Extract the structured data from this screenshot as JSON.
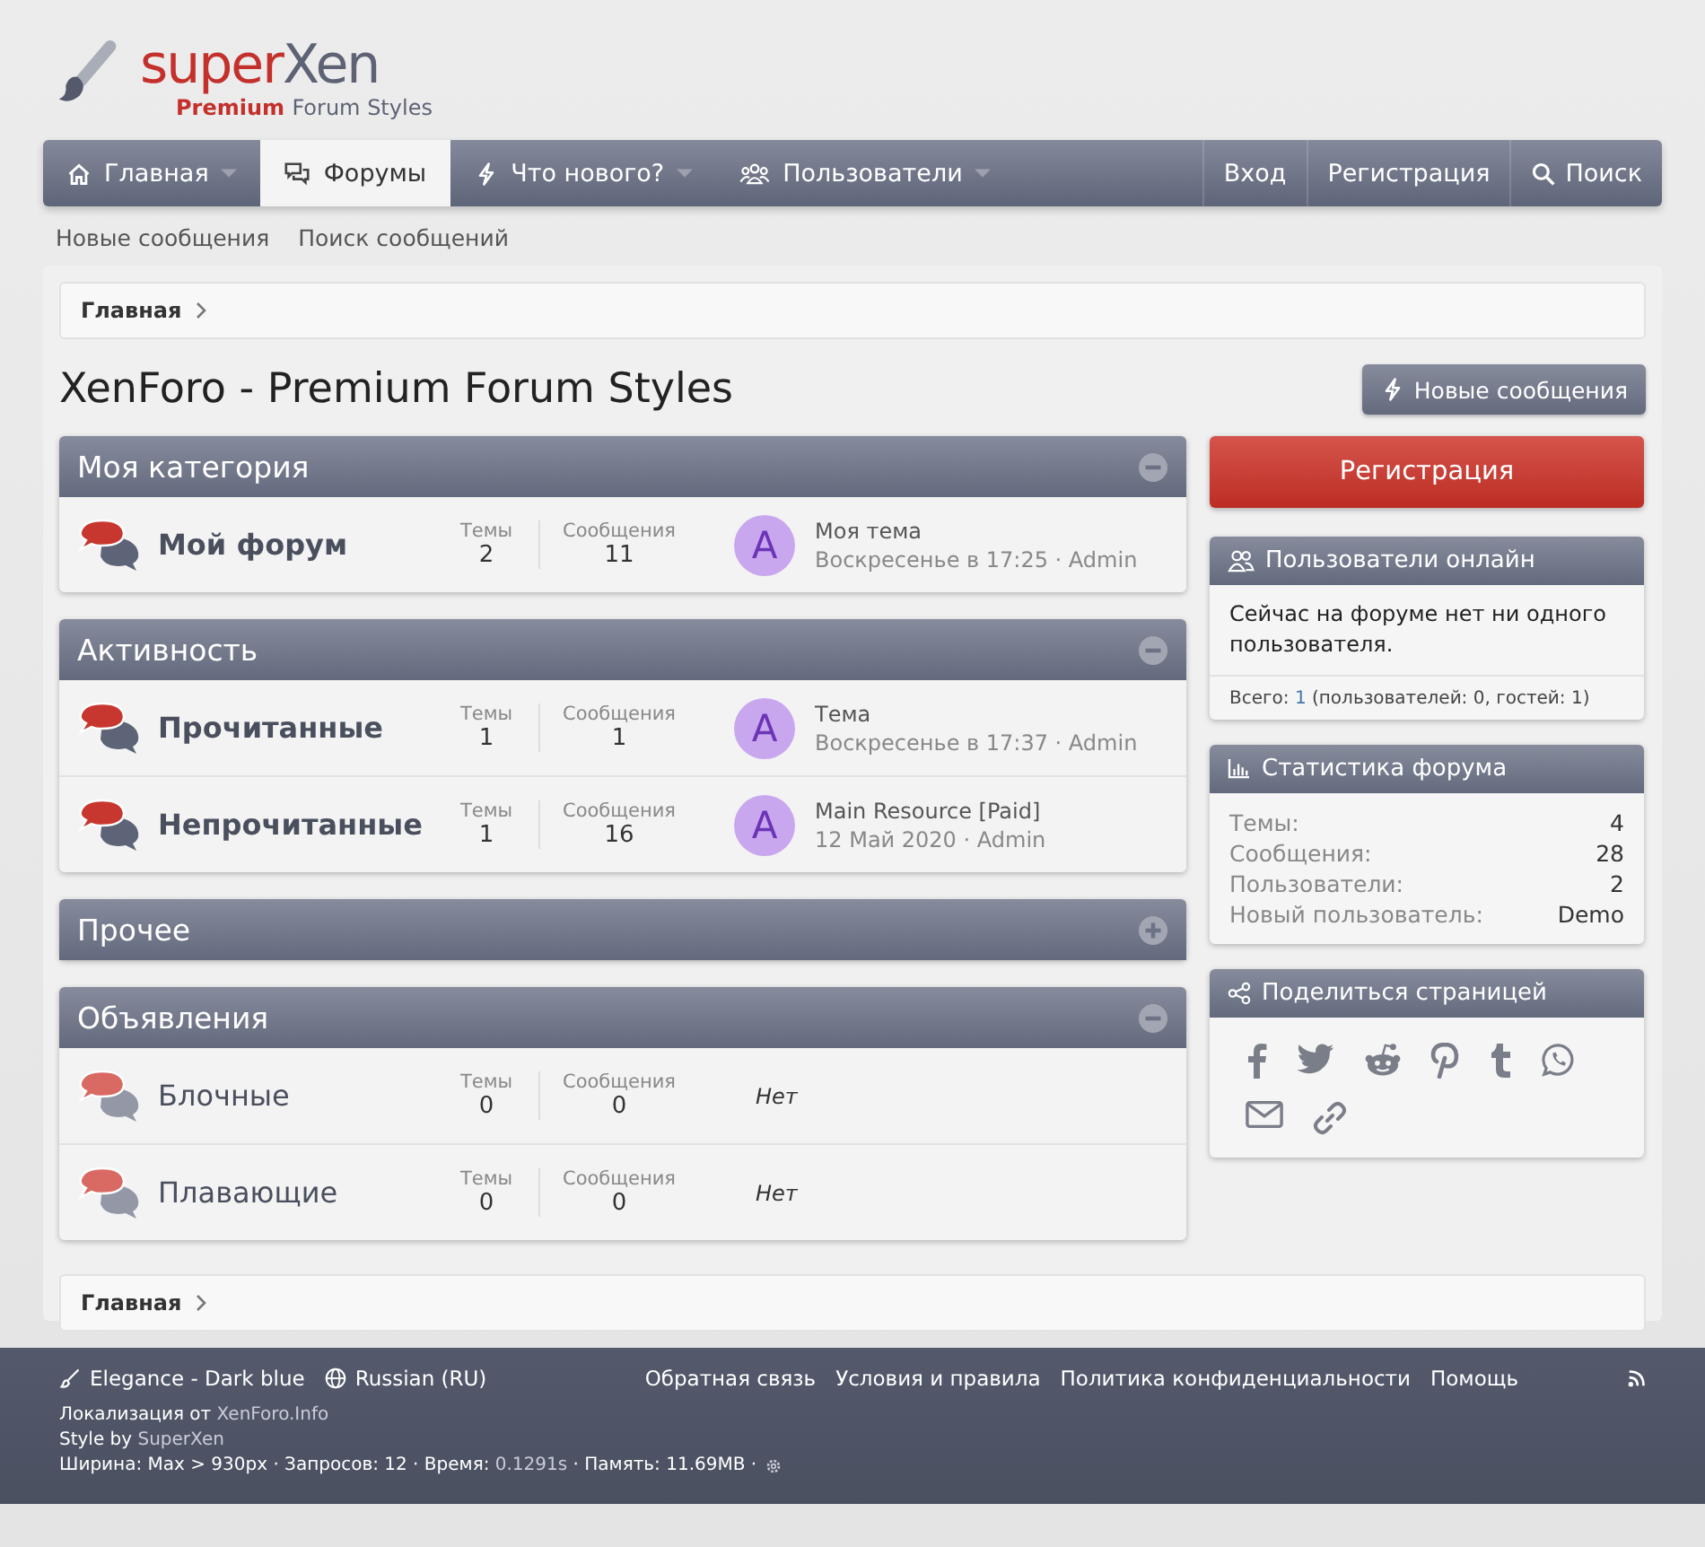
{
  "logo": {
    "name_first": "super",
    "name_second": "Xen",
    "tagline_first": "Premium",
    "tagline_second": "Forum Styles"
  },
  "nav": {
    "tabs": [
      {
        "label": "Главная",
        "selected": false,
        "has_menu": true
      },
      {
        "label": "Форумы",
        "selected": true,
        "has_menu": false
      },
      {
        "label": "Что нового?",
        "selected": false,
        "has_menu": true
      },
      {
        "label": "Пользователи",
        "selected": false,
        "has_menu": true
      }
    ],
    "actions": [
      {
        "label": "Вход",
        "kind": "login"
      },
      {
        "label": "Регистрация",
        "kind": "register"
      },
      {
        "label": "Поиск",
        "kind": "search"
      }
    ]
  },
  "subnav": [
    "Новые сообщения",
    "Поиск сообщений"
  ],
  "breadcrumb_top": "Главная",
  "page_title": "XenForo - Premium Forum Styles",
  "new_posts_button": "Новые сообщения",
  "categories": [
    {
      "title": "Моя категория",
      "collapsed": false,
      "nodes": [
        {
          "title": "Мой форум",
          "unread": true,
          "stats": [
            {
              "label": "Темы",
              "value": "2"
            },
            {
              "label": "Сообщения",
              "value": "11"
            }
          ],
          "last_post": {
            "avatar_letter": "A",
            "title": "Моя тема",
            "meta": "Воскресенье в 17:25 · Admin"
          }
        }
      ]
    },
    {
      "title": "Активность",
      "collapsed": false,
      "nodes": [
        {
          "title": "Прочитанные",
          "unread": true,
          "stats": [
            {
              "label": "Темы",
              "value": "1"
            },
            {
              "label": "Сообщения",
              "value": "1"
            }
          ],
          "last_post": {
            "avatar_letter": "A",
            "title": "Тема",
            "meta": "Воскресенье в 17:37 · Admin"
          }
        },
        {
          "title": "Непрочитанные",
          "unread": true,
          "stats": [
            {
              "label": "Темы",
              "value": "1"
            },
            {
              "label": "Сообщения",
              "value": "16"
            }
          ],
          "last_post": {
            "avatar_letter": "A",
            "title": "Main Resource [Paid]",
            "meta": "12 Май 2020 · Admin"
          }
        }
      ]
    },
    {
      "title": "Прочее",
      "collapsed": true
    },
    {
      "title": "Объявления",
      "collapsed": false,
      "nodes": [
        {
          "title": "Блочные",
          "unread": false,
          "stats": [
            {
              "label": "Темы",
              "value": "0"
            },
            {
              "label": "Сообщения",
              "value": "0"
            }
          ],
          "no_posts": "Нет"
        },
        {
          "title": "Плавающие",
          "unread": false,
          "stats": [
            {
              "label": "Темы",
              "value": "0"
            },
            {
              "label": "Сообщения",
              "value": "0"
            }
          ],
          "no_posts": "Нет"
        }
      ]
    }
  ],
  "breadcrumb_bottom": "Главная",
  "sidebar": {
    "register_button": "Регистрация",
    "online": {
      "title": "Пользователи онлайн",
      "text": "Сейчас на форуме нет ни одного пользователя.",
      "total_label": "Всего:",
      "total_value": "1",
      "total_detail": "(пользователей: 0, гостей: 1)"
    },
    "stats": {
      "title": "Статистика форума",
      "rows": [
        {
          "label": "Темы:",
          "value": "4"
        },
        {
          "label": "Сообщения:",
          "value": "28"
        },
        {
          "label": "Пользователи:",
          "value": "2"
        },
        {
          "label": "Новый пользователь:",
          "value": "Demo"
        }
      ]
    },
    "share": {
      "title": "Поделиться страницей"
    }
  },
  "footer": {
    "style": "Elegance - Dark blue",
    "language": "Russian (RU)",
    "links": [
      "Обратная связь",
      "Условия и правила",
      "Политика конфиденциальности",
      "Помощь"
    ],
    "credits": [
      {
        "text": "Локализация от",
        "link": "XenForo.Info"
      },
      {
        "text": "Style by",
        "link": "SuperXen"
      }
    ],
    "debug": {
      "before": "Ширина: Max > 930px · Запросов: 12 · Время:",
      "time": "0.1291s",
      "after": "· Память: 11.69MB ·"
    }
  }
}
